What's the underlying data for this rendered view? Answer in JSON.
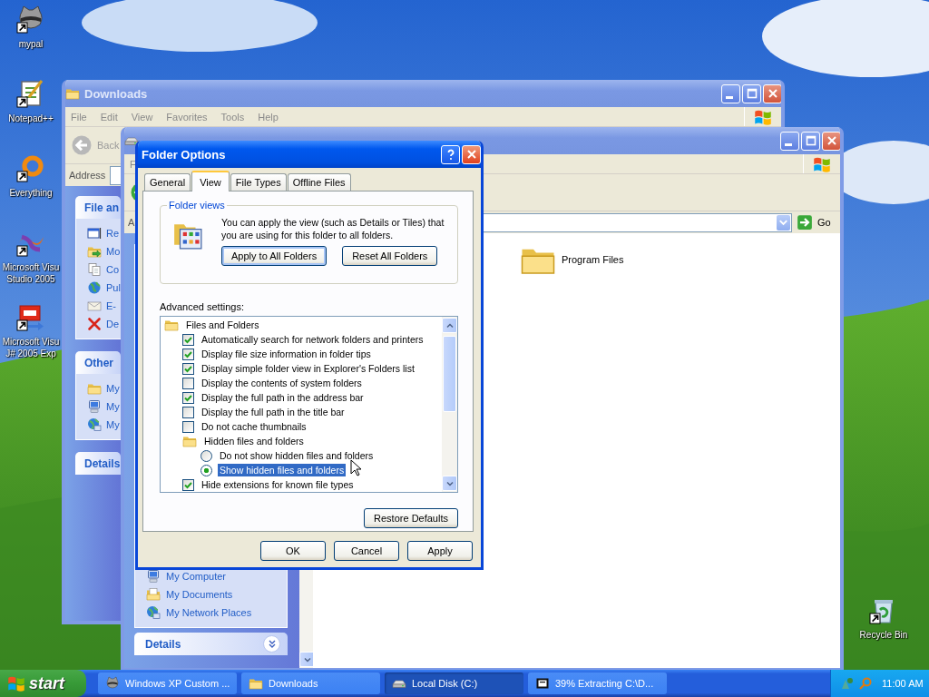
{
  "desktop_icons": [
    {
      "kind": "raccoon",
      "label": "mypal"
    },
    {
      "kind": "notepad",
      "label": "Notepad++"
    },
    {
      "kind": "ring",
      "label": "Everything"
    },
    {
      "kind": "studio",
      "label": "Microsoft Visu\nStudio 2005"
    },
    {
      "kind": "vj",
      "label": "Microsoft Visu\nJ# 2005 Exp"
    }
  ],
  "recycle_bin": {
    "kind": "recycle",
    "label": "Recycle Bin"
  },
  "downloads_window": {
    "title": "Downloads",
    "menu": [
      "File",
      "Edit",
      "View",
      "Favorites",
      "Tools",
      "Help"
    ],
    "back": {
      "label": "Back",
      "disabled": true
    },
    "address_label": "Address",
    "panels": [
      {
        "title": "File an",
        "items": [
          {
            "kind": "window",
            "label": "Re"
          },
          {
            "kind": "move",
            "label": "Mo"
          },
          {
            "kind": "copy",
            "label": "Co"
          },
          {
            "kind": "globe",
            "label": "Pul"
          },
          {
            "kind": "mail",
            "label": "E-"
          },
          {
            "kind": "delete",
            "label": "De"
          }
        ]
      },
      {
        "title": "Other",
        "items": [
          {
            "kind": "folder",
            "label": "My"
          },
          {
            "kind": "computer",
            "label": "My"
          },
          {
            "kind": "network",
            "label": "My"
          }
        ]
      },
      {
        "title": "Details"
      }
    ]
  },
  "local_disk_window": {
    "menu": [
      "F"
    ],
    "back": {
      "disabled": false
    },
    "address_label": "A",
    "go": "Go",
    "panels": [
      {
        "items": [
          {
            "kind": "computer",
            "label": "My Computer"
          },
          {
            "kind": "documents",
            "label": "My Documents"
          },
          {
            "kind": "network",
            "label": "My Network Places"
          }
        ]
      },
      {
        "title": "Details",
        "expanded": false
      }
    ],
    "files": [
      {
        "kind": "folder",
        "label": "Program Files"
      }
    ]
  },
  "dialog": {
    "title": "Folder Options",
    "tabs": [
      {
        "label": "General",
        "selected": false
      },
      {
        "label": "View",
        "selected": true
      },
      {
        "label": "File Types",
        "selected": false
      },
      {
        "label": "Offline Files",
        "selected": false
      }
    ],
    "folder_views": {
      "legend": "Folder views",
      "text": "You can apply the view (such as Details or Tiles) that you are using for this folder to all folders.",
      "buttons": [
        {
          "label": "Apply to All Folders",
          "default": true
        },
        {
          "label": "Reset All Folders",
          "default": false
        }
      ]
    },
    "advanced_label": "Advanced settings:",
    "settings": [
      {
        "kind": "group",
        "label": "Files and Folders",
        "children": [
          {
            "kind": "checkbox",
            "label": "Automatically search for network folders and printers",
            "checked": true
          },
          {
            "kind": "checkbox",
            "label": "Display file size information in folder tips",
            "checked": true
          },
          {
            "kind": "checkbox",
            "label": "Display simple folder view in Explorer's Folders list",
            "checked": true
          },
          {
            "kind": "checkbox",
            "label": "Display the contents of system folders",
            "checked": false
          },
          {
            "kind": "checkbox",
            "label": "Display the full path in the address bar",
            "checked": true
          },
          {
            "kind": "checkbox",
            "label": "Display the full path in the title bar",
            "checked": false
          },
          {
            "kind": "checkbox",
            "label": "Do not cache thumbnails",
            "checked": false
          },
          {
            "kind": "group",
            "label": "Hidden files and folders",
            "children": [
              {
                "kind": "radio",
                "label": "Do not show hidden files and folders",
                "selected": false
              },
              {
                "kind": "radio",
                "label": "Show hidden files and folders",
                "selected": true
              }
            ]
          },
          {
            "kind": "checkbox",
            "label": "Hide extensions for known file types",
            "checked": true
          }
        ]
      }
    ],
    "restore": "Restore Defaults",
    "buttons": [
      "OK",
      "Cancel",
      "Apply"
    ]
  },
  "taskbar": {
    "start": "start",
    "tasks": [
      {
        "kind": "raccoon",
        "label": "Windows XP Custom ...",
        "selected": false
      },
      {
        "kind": "folder",
        "label": "Downloads",
        "selected": false
      },
      {
        "kind": "drive",
        "label": "Local Disk (C:)",
        "selected": true
      },
      {
        "kind": "zip",
        "label": "39% Extracting C:\\D...",
        "selected": false
      }
    ],
    "clock": "11:00 AM"
  }
}
